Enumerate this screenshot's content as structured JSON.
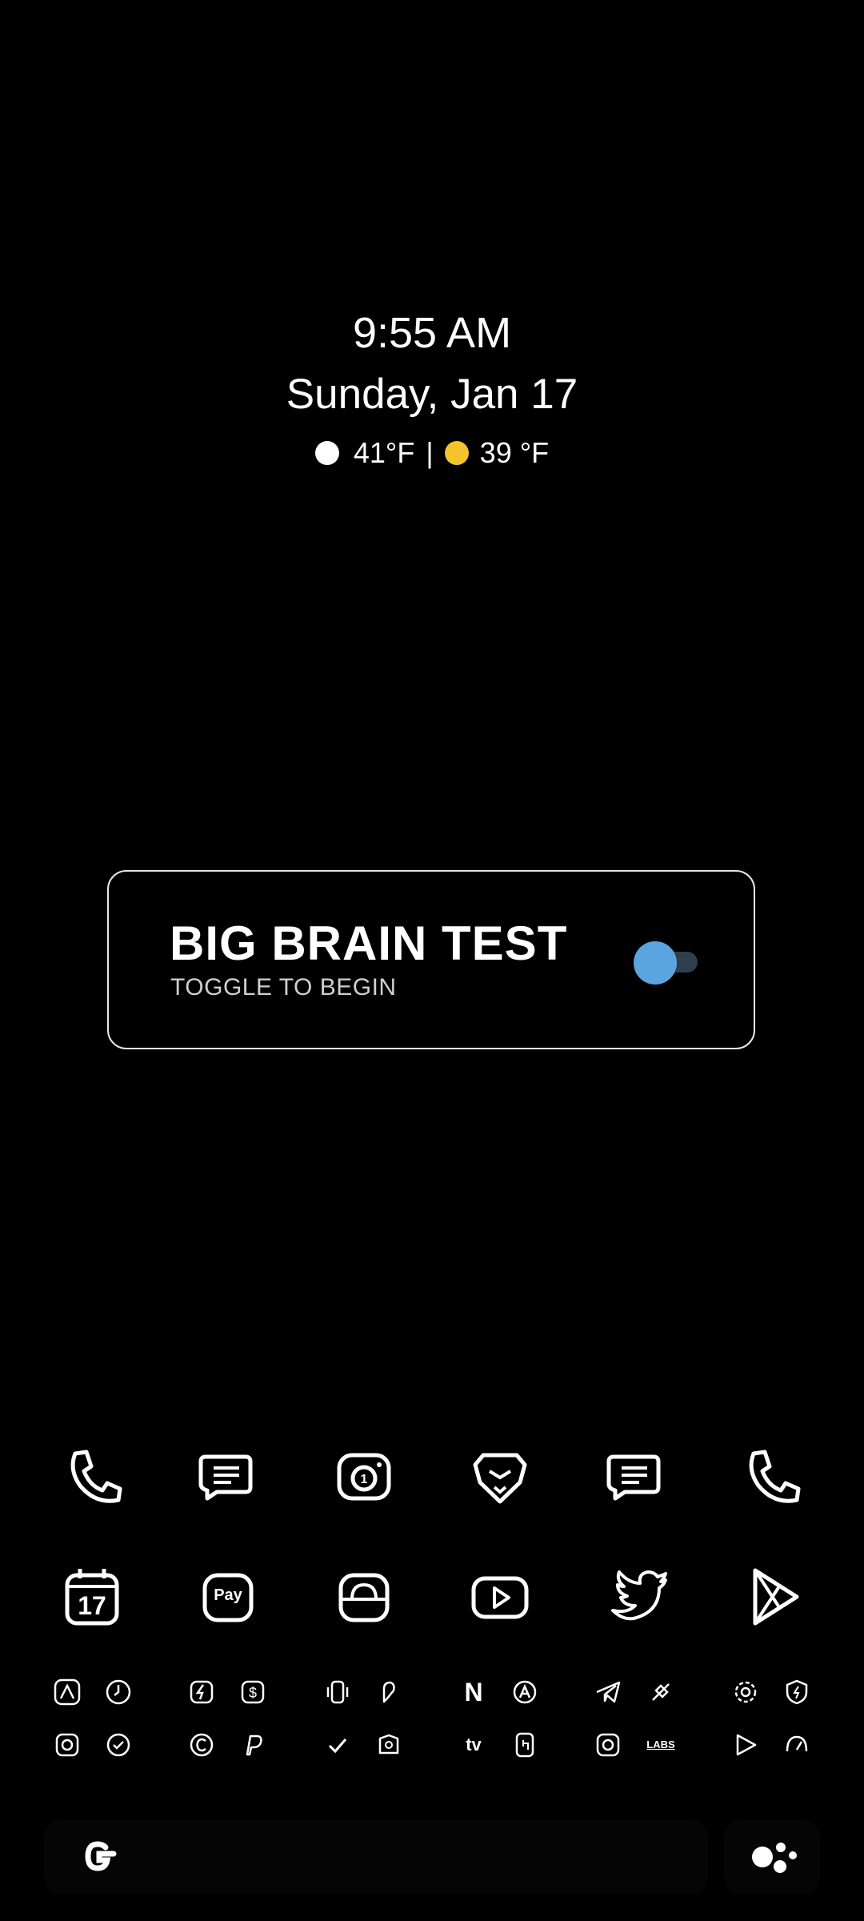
{
  "clock": {
    "time": "9:55 AM",
    "date": "Sunday, Jan 17"
  },
  "weather": {
    "current": "41°F",
    "separator": "|",
    "forecast": "39 °F",
    "current_icon_color": "#ffffff",
    "forecast_icon_color": "#f4c42b"
  },
  "card": {
    "title": "BIG BRAIN TEST",
    "subtitle": "TOGGLE TO BEGIN",
    "toggle_state": "on",
    "accent": "#5aa5e0"
  },
  "dock": {
    "row1": [
      "phone-icon",
      "messages-icon",
      "camera-icon",
      "brave-icon",
      "messages-icon",
      "phone-icon"
    ],
    "row2": [
      "calendar-icon",
      "gpay-icon",
      "store-icon",
      "youtube-icon",
      "twitter-icon",
      "play-store-icon"
    ],
    "calendar_day": "17",
    "pay_label": "Pay"
  },
  "folders": {
    "labs_label": "LABS",
    "netflix_label": "N",
    "tv_label": "tv"
  },
  "search_bar": {
    "google_label": "G"
  }
}
